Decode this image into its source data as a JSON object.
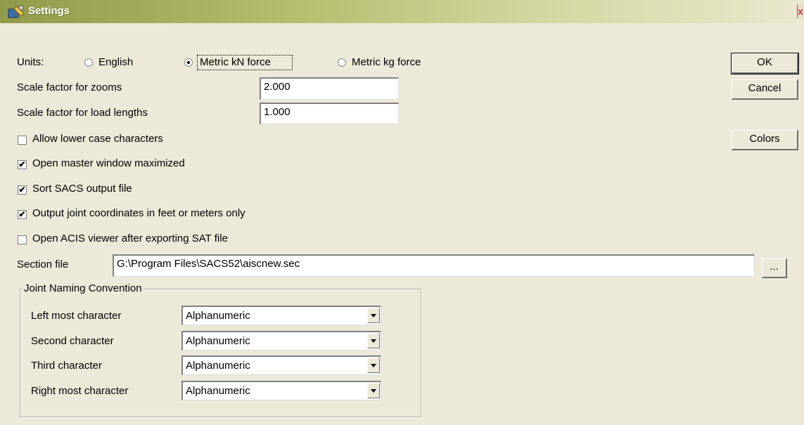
{
  "window": {
    "title": "Settings",
    "close_glyph": "x"
  },
  "units": {
    "label": "Units:",
    "options": [
      {
        "label": "English",
        "selected": false
      },
      {
        "label": "Metric kN force",
        "selected": true
      },
      {
        "label": "Metric kg force",
        "selected": false
      }
    ]
  },
  "zoom_scale": {
    "label": "Scale factor for zooms",
    "value": "2.000"
  },
  "load_scale": {
    "label": "Scale factor for load lengths",
    "value": "1.000"
  },
  "options": [
    {
      "label": "Allow lower case characters",
      "checked": false
    },
    {
      "label": "Open master window maximized",
      "checked": true
    },
    {
      "label": "Sort SACS output file",
      "checked": true
    },
    {
      "label": "Output joint coordinates in feet or meters only",
      "checked": true
    },
    {
      "label": "Open ACIS viewer after exporting SAT file",
      "checked": false
    }
  ],
  "section_file": {
    "label": "Section file",
    "value": "G:\\Program Files\\SACS52\\aiscnew.sec",
    "browse_label": "..."
  },
  "joint_naming": {
    "title": "Joint Naming Convention",
    "rows": [
      {
        "label": "Left most character",
        "value": "Alphanumeric"
      },
      {
        "label": "Second character",
        "value": "Alphanumeric"
      },
      {
        "label": "Third character",
        "value": "Alphanumeric"
      },
      {
        "label": "Right most character",
        "value": "Alphanumeric"
      }
    ]
  },
  "buttons": {
    "ok": "OK",
    "cancel": "Cancel",
    "colors": "Colors"
  },
  "check_glyph": "✔",
  "icons": {
    "title": "settings-app-icon",
    "dropdown": "chevron-down-icon"
  }
}
